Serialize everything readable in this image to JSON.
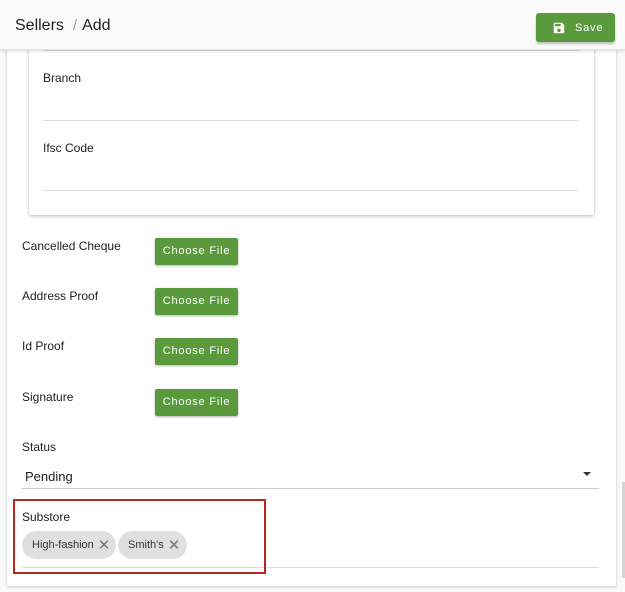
{
  "header": {
    "breadcrumb_parent": "Sellers",
    "breadcrumb_separator": "/",
    "breadcrumb_current": "Add",
    "save_label": "Save"
  },
  "bank_details": {
    "branch_label": "Branch",
    "ifsc_label": "Ifsc Code"
  },
  "documents": {
    "cancelled_cheque_label": "Cancelled Cheque",
    "address_proof_label": "Address Proof",
    "id_proof_label": "Id Proof",
    "signature_label": "Signature",
    "choose_file_label": "Choose File"
  },
  "status": {
    "label": "Status",
    "value": "Pending"
  },
  "substore": {
    "label": "Substore",
    "chips": [
      "High-fashion",
      "Smith's"
    ]
  },
  "colors": {
    "primary_green": "#5a9a3c",
    "highlight_red": "#b5281c"
  }
}
